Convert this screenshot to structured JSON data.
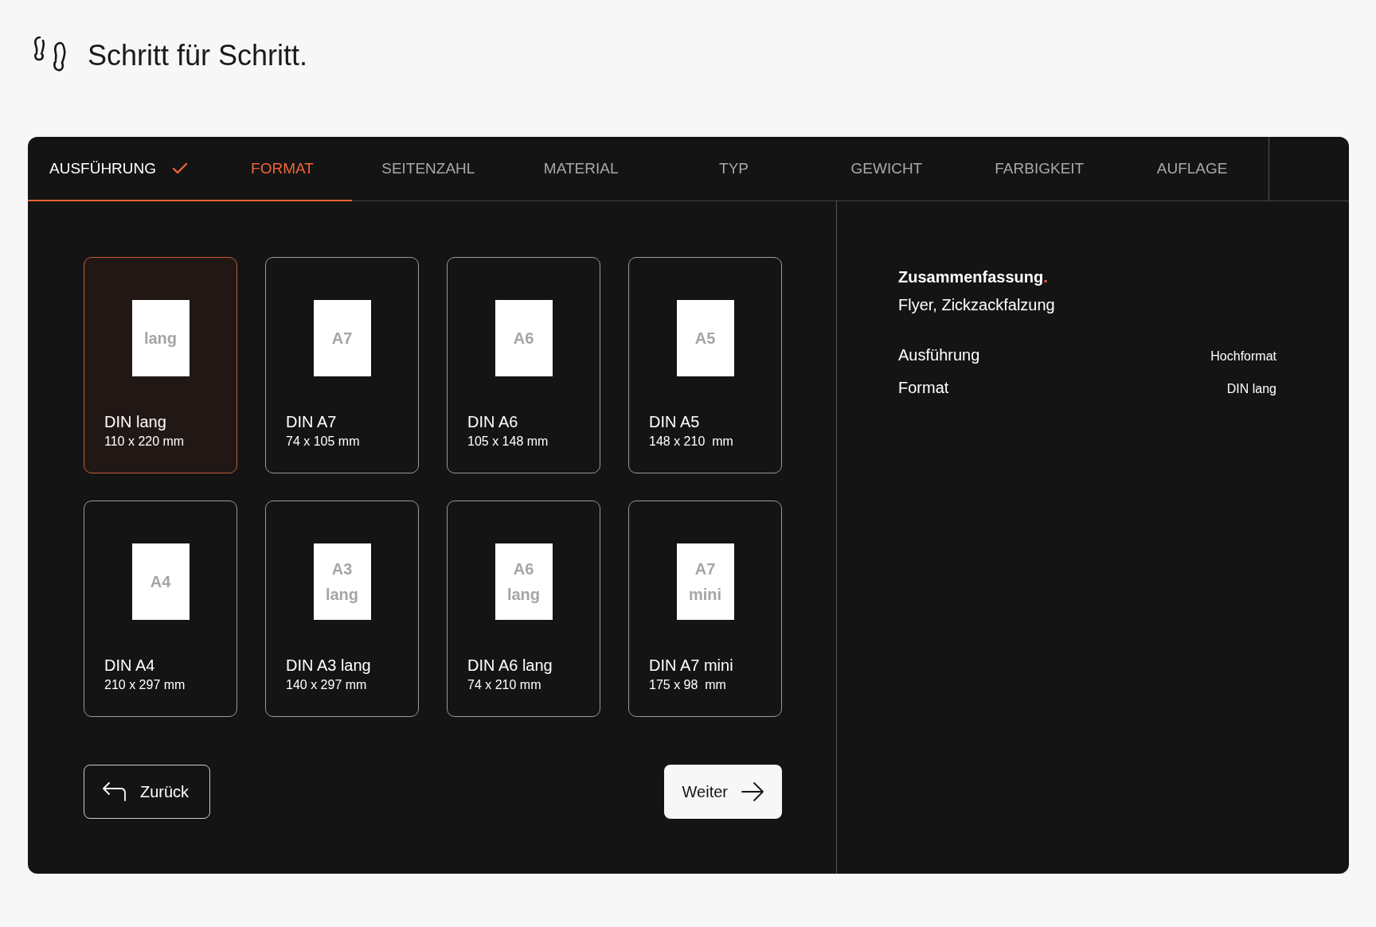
{
  "header": {
    "title": "Schritt für Schritt."
  },
  "tabs": [
    {
      "label": "AUSFÜHRUNG",
      "completed": true,
      "selected": false
    },
    {
      "label": "FORMAT",
      "completed": false,
      "selected": true
    },
    {
      "label": "SEITENZAHL",
      "completed": false,
      "selected": false
    },
    {
      "label": "MATERIAL",
      "completed": false,
      "selected": false
    },
    {
      "label": "TYP",
      "completed": false,
      "selected": false
    },
    {
      "label": "GEWICHT",
      "completed": false,
      "selected": false
    },
    {
      "label": "FARBIGKEIT",
      "completed": false,
      "selected": false
    },
    {
      "label": "AUFLAGE",
      "completed": false,
      "selected": false
    }
  ],
  "formats": [
    {
      "paper_label": [
        "lang"
      ],
      "name": "DIN lang",
      "size": "110 x 220 mm",
      "selected": true
    },
    {
      "paper_label": [
        "A7"
      ],
      "name": "DIN A7",
      "size": "74 x 105 mm",
      "selected": false
    },
    {
      "paper_label": [
        "A6"
      ],
      "name": "DIN A6",
      "size": "105 x 148 mm",
      "selected": false
    },
    {
      "paper_label": [
        "A5"
      ],
      "name": "DIN A5",
      "size": "148 x 210  mm",
      "selected": false
    },
    {
      "paper_label": [
        "A4"
      ],
      "name": "DIN A4",
      "size": "210 x 297 mm",
      "selected": false
    },
    {
      "paper_label": [
        "A3",
        "lang"
      ],
      "name": "DIN A3 lang",
      "size": "140 x 297 mm",
      "selected": false
    },
    {
      "paper_label": [
        "A6",
        "lang"
      ],
      "name": "DIN A6 lang",
      "size": "74 x 210 mm",
      "selected": false
    },
    {
      "paper_label": [
        "A7",
        "mini"
      ],
      "name": "DIN A7 mini",
      "size": "175 x 98  mm",
      "selected": false
    }
  ],
  "buttons": {
    "back": "Zurück",
    "next": "Weiter"
  },
  "summary": {
    "title": "Zusammenfassung",
    "title_dot": ".",
    "subtitle": "Flyer, Zickzackfalzung",
    "rows": [
      {
        "label": "Ausführung",
        "value": "Hochformat"
      },
      {
        "label": "Format",
        "value": "DIN lang"
      }
    ]
  }
}
